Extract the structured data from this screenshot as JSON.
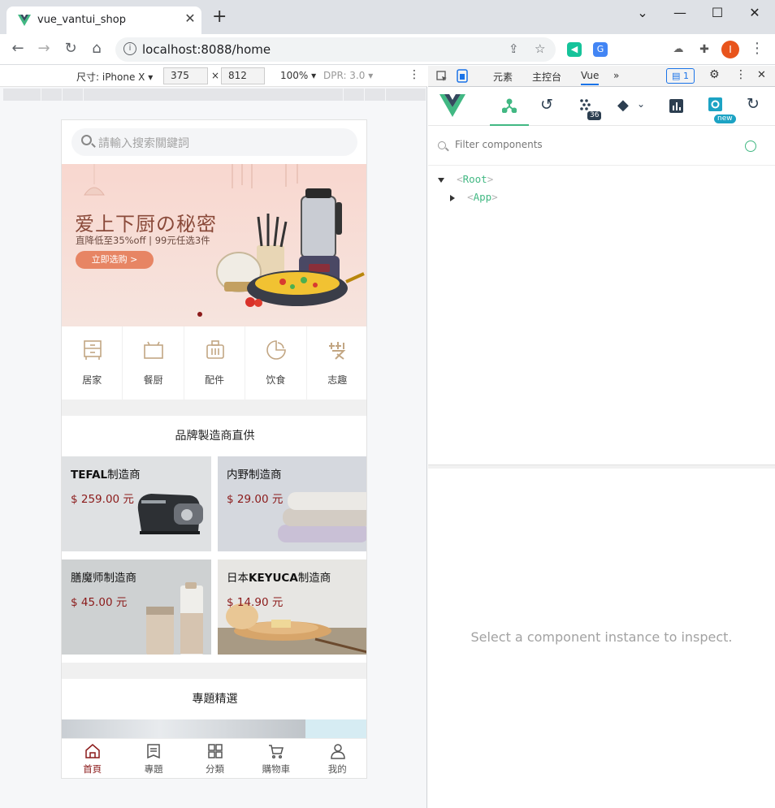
{
  "browser": {
    "tab_title": "vue_vantui_shop",
    "url": "localhost:8088/home",
    "profile_initial": "I",
    "accent": "#1a73e8"
  },
  "device_toolbar": {
    "size_label": "尺寸: iPhone X",
    "width": "375",
    "times": "×",
    "height": "812",
    "zoom": "100%",
    "dpr": "DPR: 3.0"
  },
  "app": {
    "search_placeholder": "請輸入搜索關鍵詞",
    "banner": {
      "headline": "爱上下厨の秘密",
      "subline": "直降低至35%off | 99元任选3件",
      "cta": "立即选购 >"
    },
    "categories": [
      {
        "label": "居家",
        "icon": "cabinet-icon"
      },
      {
        "label": "餐厨",
        "icon": "pot-icon"
      },
      {
        "label": "配件",
        "icon": "luggage-icon"
      },
      {
        "label": "饮食",
        "icon": "food-icon"
      },
      {
        "label": "志趣",
        "icon": "hobby-icon"
      }
    ],
    "brand_section_title": "品牌製造商直供",
    "brands": [
      {
        "name_bold": "TEFAL",
        "name_rest": "制造商",
        "price": "$ 259.00 元"
      },
      {
        "name_bold": "",
        "name_rest": "内野制造商",
        "price": "$ 29.00 元"
      },
      {
        "name_bold": "",
        "name_rest": "膳魔师制造商",
        "price": "$ 45.00 元"
      },
      {
        "name_bold": "KEYUCA",
        "name_prefix": "日本",
        "name_rest": "制造商",
        "price": "$ 14.90 元"
      }
    ],
    "topic_section_title": "專題精選",
    "tabbar": [
      {
        "label": "首頁",
        "icon": "home-icon",
        "active": true
      },
      {
        "label": "專題",
        "icon": "document-icon",
        "active": false
      },
      {
        "label": "分類",
        "icon": "grid-icon",
        "active": false
      },
      {
        "label": "購物車",
        "icon": "cart-icon",
        "active": false
      },
      {
        "label": "我的",
        "icon": "user-icon",
        "active": false
      }
    ],
    "accent": "#8b1a1a"
  },
  "devtools": {
    "tabs": [
      "元素",
      "主控台",
      "Vue"
    ],
    "more": "»",
    "issues_count": "1",
    "vue_toolbar": {
      "timeline_count": "36",
      "new_badge": "new"
    },
    "filter_placeholder": "Filter components",
    "tree": [
      {
        "name": "Root",
        "lt": "<",
        "gt": ">"
      },
      {
        "name": "App",
        "lt": "<",
        "gt": ">"
      }
    ],
    "inspect_hint": "Select a component instance to inspect.",
    "vue_green": "#42b883"
  }
}
